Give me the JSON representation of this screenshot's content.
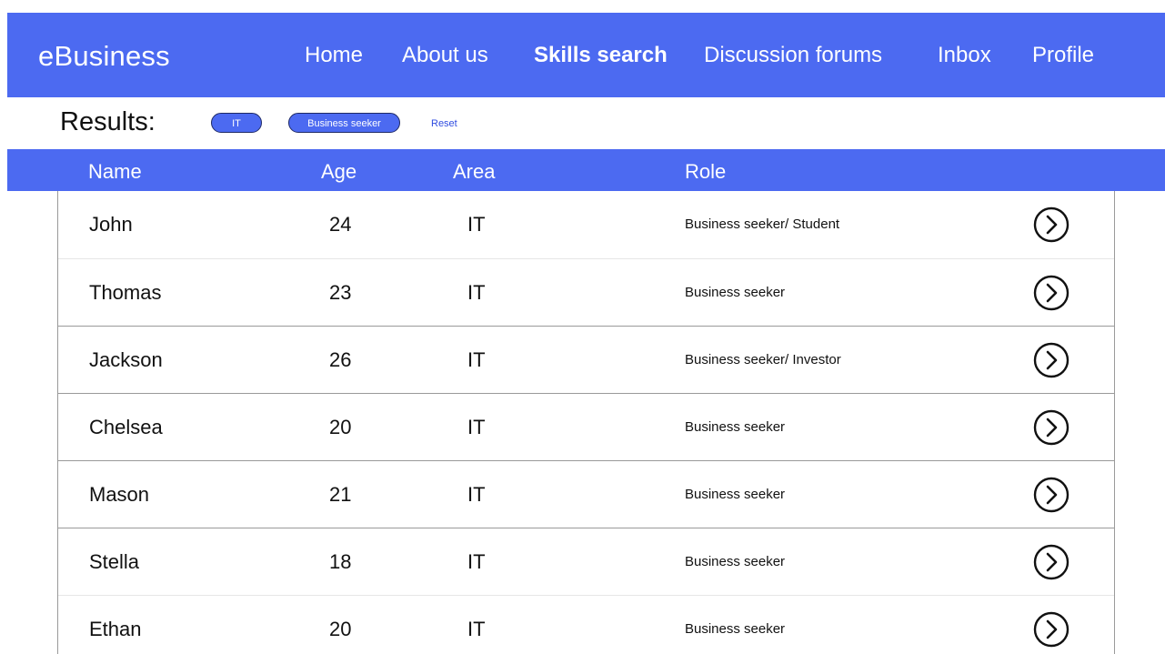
{
  "header": {
    "brand": "eBusiness",
    "nav": [
      {
        "label": "Home",
        "active": false
      },
      {
        "label": "About us",
        "active": false
      },
      {
        "label": "Skills search",
        "active": true
      },
      {
        "label": "Discussion forums",
        "active": false
      },
      {
        "label": "Inbox",
        "active": false
      },
      {
        "label": "Profile",
        "active": false
      }
    ]
  },
  "filters": {
    "results_label": "Results:",
    "chips": [
      "IT",
      "Business seeker"
    ],
    "reset_label": "Reset"
  },
  "table": {
    "columns": [
      "Name",
      "Age",
      "Area",
      "Role"
    ],
    "rows": [
      {
        "name": "John",
        "age": "24",
        "area": "IT",
        "role": "Business seeker/ Student"
      },
      {
        "name": "Thomas",
        "age": "23",
        "area": "IT",
        "role": "Business seeker"
      },
      {
        "name": "Jackson",
        "age": "26",
        "area": "IT",
        "role": "Business seeker/ Investor"
      },
      {
        "name": "Chelsea",
        "age": "20",
        "area": "IT",
        "role": "Business seeker"
      },
      {
        "name": "Mason",
        "age": "21",
        "area": "IT",
        "role": "Business seeker"
      },
      {
        "name": "Stella",
        "age": "18",
        "area": "IT",
        "role": "Business seeker"
      },
      {
        "name": "Ethan",
        "age": "20",
        "area": "IT",
        "role": "Business seeker"
      }
    ],
    "row_action_icon": "chevron-right-circle-icon"
  },
  "colors": {
    "accent": "#4c6af1",
    "text": "#111111",
    "link": "#2f4ce0",
    "border": "#9a9a9a"
  }
}
